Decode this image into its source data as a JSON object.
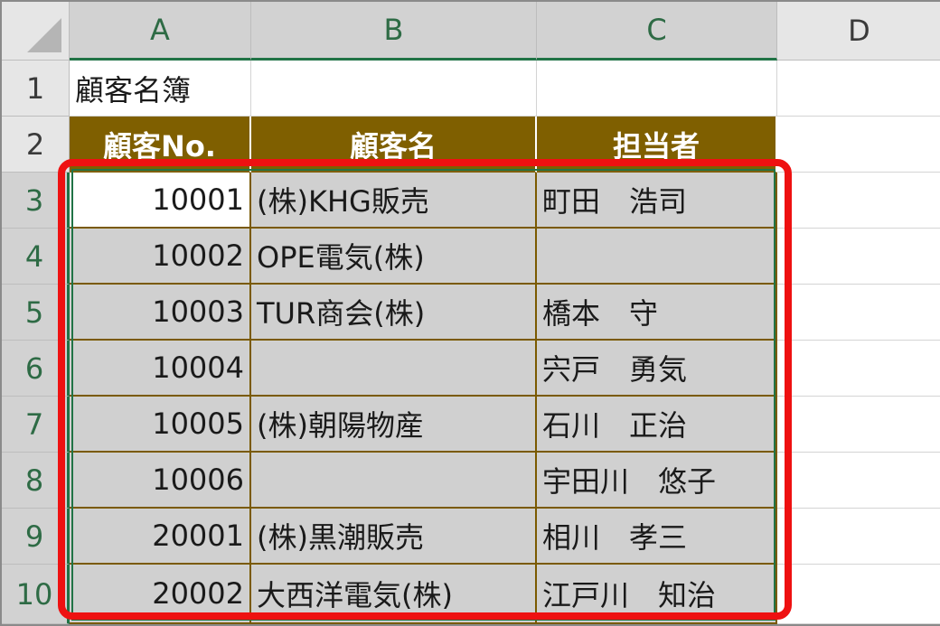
{
  "columns": [
    "A",
    "B",
    "C",
    "D"
  ],
  "rows": [
    "1",
    "2",
    "3",
    "4",
    "5",
    "6",
    "7",
    "8",
    "9",
    "10"
  ],
  "title": "顧客名簿",
  "headers": [
    "顧客No.",
    "顧客名",
    "担当者"
  ],
  "records": [
    [
      "10001",
      "(株)KHG販売",
      "町田　浩司"
    ],
    [
      "10002",
      "OPE電気(株)",
      ""
    ],
    [
      "10003",
      "TUR商会(株)",
      "橋本　守"
    ],
    [
      "10004",
      "",
      "宍戸　勇気"
    ],
    [
      "10005",
      "(株)朝陽物産",
      "石川　正治"
    ],
    [
      "10006",
      "",
      "宇田川　悠子"
    ],
    [
      "20001",
      "(株)黒潮販売",
      "相川　孝三"
    ],
    [
      "20002",
      "大西洋電気(株)",
      "江戸川　知治"
    ]
  ],
  "colors": {
    "header_fill": "#7f5f00",
    "selection_fill": "#d0d0d0",
    "selection_border": "#217346",
    "highlight": "#ee1111"
  }
}
